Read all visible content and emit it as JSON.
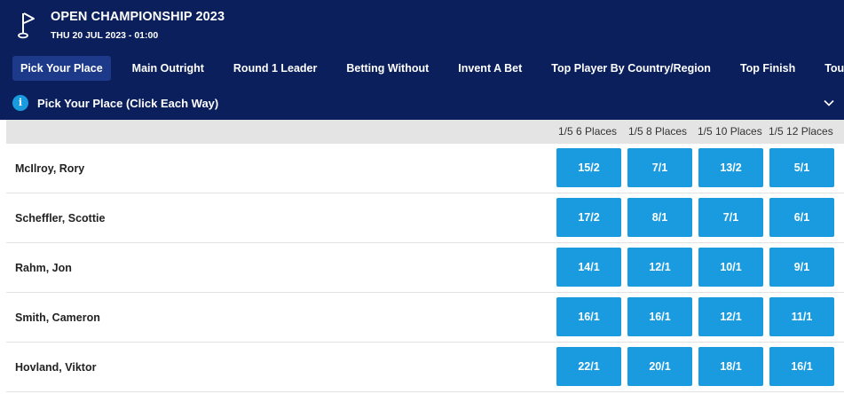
{
  "event": {
    "title": "OPEN CHAMPIONSHIP 2023",
    "date": "THU 20 JUL 2023 - 01:00",
    "icon": "golf-flag-icon"
  },
  "tabs": [
    {
      "label": "Pick Your Place",
      "active": true
    },
    {
      "label": "Main Outright",
      "active": false
    },
    {
      "label": "Round 1 Leader",
      "active": false
    },
    {
      "label": "Betting Without",
      "active": false
    },
    {
      "label": "Invent A Bet",
      "active": false
    },
    {
      "label": "Top Player By Country/Region",
      "active": false
    },
    {
      "label": "Top Finish",
      "active": false
    },
    {
      "label": "Tournament",
      "active": false
    }
  ],
  "market": {
    "info_icon_label": "i",
    "title": "Pick Your Place (Click Each Way)",
    "expanded": true
  },
  "columns": [
    "1/5 6 Places",
    "1/5 8 Places",
    "1/5 10 Places",
    "1/5 12 Places"
  ],
  "players": [
    {
      "name": "McIlroy, Rory",
      "prices": [
        "15/2",
        "7/1",
        "13/2",
        "5/1"
      ]
    },
    {
      "name": "Scheffler, Scottie",
      "prices": [
        "17/2",
        "8/1",
        "7/1",
        "6/1"
      ]
    },
    {
      "name": "Rahm, Jon",
      "prices": [
        "14/1",
        "12/1",
        "10/1",
        "9/1"
      ]
    },
    {
      "name": "Smith, Cameron",
      "prices": [
        "16/1",
        "16/1",
        "12/1",
        "11/1"
      ]
    },
    {
      "name": "Hovland, Viktor",
      "prices": [
        "22/1",
        "20/1",
        "18/1",
        "16/1"
      ]
    }
  ],
  "colors": {
    "header_bg": "#0a1f5c",
    "active_tab_bg": "#1d3a8a",
    "price_bg": "#1a9be0",
    "column_header_bg": "#e4e4e4"
  }
}
